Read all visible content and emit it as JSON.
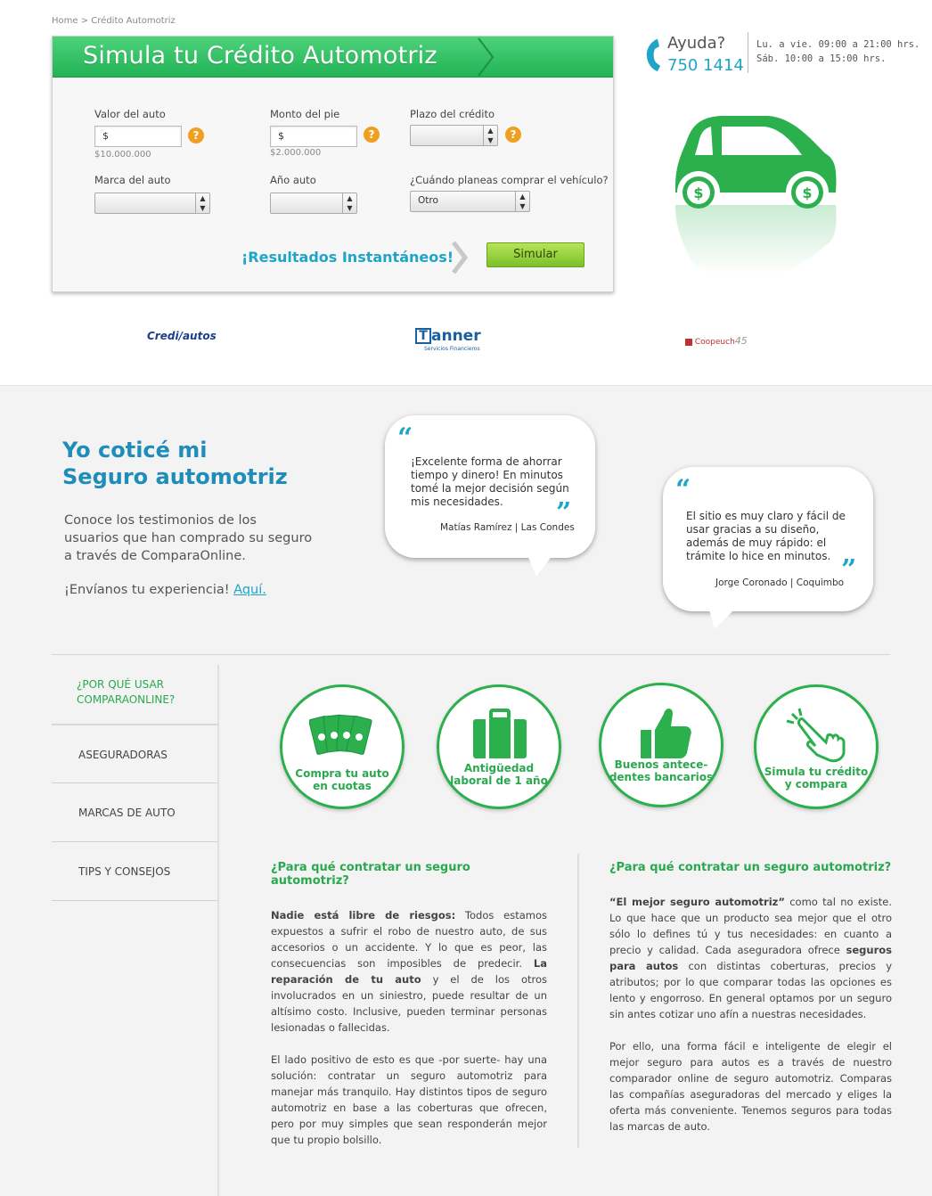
{
  "breadcrumb": {
    "home": "Home",
    "separator": ">",
    "current": "Crédito Automotriz"
  },
  "simulator": {
    "title": "Simula tu Crédito Automotriz",
    "valor_label": "Valor del auto",
    "valor_value": "$",
    "valor_hint": "$10.000.000",
    "pie_label": "Monto del pie",
    "pie_value": "$",
    "pie_hint": "$2.000.000",
    "plazo_label": "Plazo del crédito",
    "marca_label": "Marca del auto",
    "anio_label": "Año auto",
    "cuando_label": "¿Cuándo planeas comprar el vehículo?",
    "cuando_value": "Otro",
    "help_symbol": "?",
    "instant": "¡Resultados Instantáneos!",
    "button": "Simular"
  },
  "help": {
    "ayuda": "Ayuda?",
    "phone": "750 1414",
    "hours": "Lu. a vie. 09:00 a 21:00 hrs.\nSáb. 10:00 a 15:00 hrs."
  },
  "logos": {
    "crediautos": "Credi/autos",
    "tanner_letter": "T",
    "tanner": "anner",
    "tanner_sub": "Servicios Financieros",
    "coopeuch": "Coopeuch",
    "coopeuch_year": "45"
  },
  "testimonials": {
    "title_line1": "Yo coticé mi",
    "title_line2": "Seguro automotriz",
    "description": "Conoce los testimonios de los usuarios que han comprado su seguro a través de ComparaOnline.",
    "cta_text": "¡Envíanos tu experiencia!",
    "cta_link": "Aquí.",
    "quote_open": "“",
    "quote_close": "”",
    "items": [
      {
        "text": "¡Excelente forma de ahorrar tiempo y dinero! En minutos tomé la mejor decisión según mis necesidades.",
        "author": "Matías Ramírez | Las Condes"
      },
      {
        "text": "El sitio es muy claro y fácil de usar gracias a su diseño, además de muy rápido: el trámite lo hice en minutos.",
        "author": "Jorge Coronado | Coquimbo"
      }
    ]
  },
  "sidebar": {
    "heading_line1": "¿POR QUÉ USAR",
    "heading_line2": "COMPARAONLINE?",
    "items": [
      {
        "label": "ASEGURADORAS"
      },
      {
        "label": "MARCAS DE AUTO"
      },
      {
        "label": "TIPS Y CONSEJOS"
      }
    ]
  },
  "features": [
    {
      "line1": "Compra tu auto",
      "line2": "en cuotas",
      "icon": "money-bills-icon"
    },
    {
      "line1": "Antigüedad",
      "line2": "laboral de 1 año",
      "icon": "briefcase-icon"
    },
    {
      "line1": "Buenos antece-",
      "line2": "dentes bancarios",
      "icon": "thumbs-up-icon"
    },
    {
      "line1": "Simula tu crédito",
      "line2": "y compara",
      "icon": "pointer-hand-icon"
    }
  ],
  "articles": {
    "left": {
      "heading": "¿Para qué contratar un seguro automotriz?",
      "p1_bold": "Nadie está libre de riesgos:",
      "p1_a": " Todos estamos expuestos a sufrir el robo de nuestro auto, de sus accesorios o un accidente. Y lo que es peor, las consecuencias son imposibles de predecir. ",
      "p1_bold2": "La reparación de tu auto",
      "p1_b": " y el de los otros involucrados en un siniestro, puede resultar de un altísimo costo. Inclusive, pueden terminar personas lesionadas o fallecidas.",
      "p2": "El lado positivo de esto es que -por suerte- hay una solución: contratar un seguro automotriz para manejar más tranquilo. Hay distintos tipos de seguro automotriz en base a las coberturas que ofrecen, pero por muy simples que sean responderán mejor que tu propio bolsillo."
    },
    "right": {
      "heading": "¿Para qué contratar un seguro automotriz?",
      "p1_bold": "“El mejor seguro automotriz”",
      "p1_a": " como tal no existe. Lo que hace que un producto sea mejor que el otro sólo lo defines tú y tus necesidades: en cuanto a precio y calidad. Cada aseguradora ofrece ",
      "p1_bold2": "seguros para autos",
      "p1_b": " con distintas coberturas, precios y atributos; por lo que comparar todas las opciones es lento y engorroso. En general optamos por un seguro sin antes cotizar uno afín a nuestras necesidades.",
      "p2": "Por ello, una forma fácil e inteligente de elegir el mejor seguro para autos es a través de nuestro comparador online de seguro automotriz. Comparas las compañías aseguradoras del mercado y eliges la oferta más conveniente. Tenemos seguros para todas las marcas de auto."
    }
  },
  "colors": {
    "green": "#2bb04d",
    "blue": "#1ea5c8",
    "orange": "#f0a020"
  }
}
